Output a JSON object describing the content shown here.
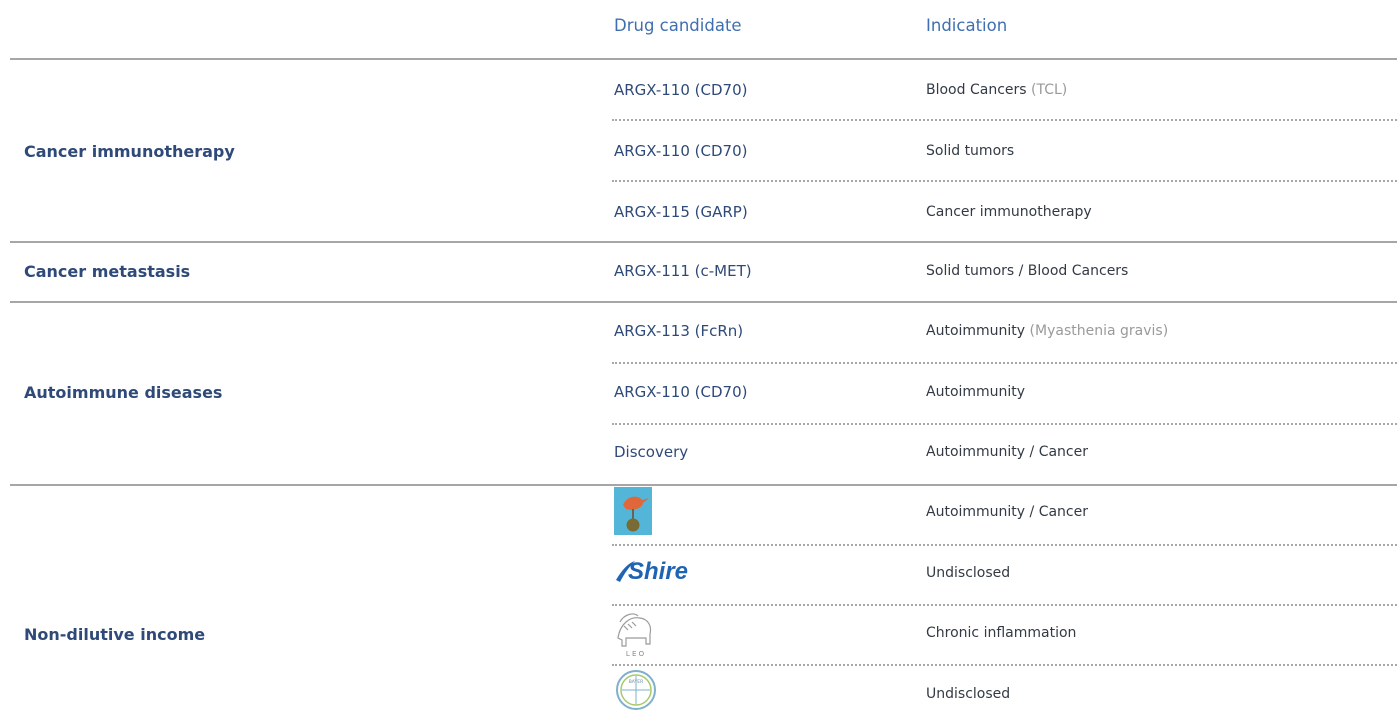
{
  "header": {
    "drug_candidate": "Drug candidate",
    "indication": "Indication"
  },
  "groups": [
    {
      "category": "Cancer immunotherapy"
    },
    {
      "category": "Cancer metastasis"
    },
    {
      "category": "Autoimmune diseases"
    },
    {
      "category": "Non-dilutive income"
    }
  ],
  "rows": [
    {
      "drug": "ARGX-110 (CD70)",
      "indication": "Blood Cancers",
      "indication_note": "(TCL)"
    },
    {
      "drug": "ARGX-110 (CD70)",
      "indication": "Solid tumors",
      "indication_note": ""
    },
    {
      "drug": "ARGX-115 (GARP)",
      "indication": "Cancer immunotherapy",
      "indication_note": ""
    },
    {
      "drug": "ARGX-111 (c-MET)",
      "indication": "Solid tumors / Blood Cancers",
      "indication_note": ""
    },
    {
      "drug": "ARGX-113 (FcRn)",
      "indication": "Autoimmunity",
      "indication_note": "(Myasthenia gravis)"
    },
    {
      "drug": "ARGX-110 (CD70)",
      "indication": "Autoimmunity",
      "indication_note": ""
    },
    {
      "drug": "Discovery",
      "indication": "Autoimmunity / Cancer",
      "indication_note": ""
    },
    {
      "drug_logo": "bird-logo",
      "indication": "Autoimmunity / Cancer",
      "indication_note": ""
    },
    {
      "drug_logo": "shire-logo",
      "logo_text": "Shire",
      "indication": "Undisclosed",
      "indication_note": ""
    },
    {
      "drug_logo": "lion-logo",
      "logo_text": "L E O",
      "indication": "Chronic inflammation",
      "indication_note": ""
    },
    {
      "drug_logo": "bayer-logo",
      "logo_text": "BAYER",
      "indication": "Undisclosed",
      "indication_note": ""
    }
  ],
  "colors": {
    "header_blue": "#3f6fb0",
    "text_navy": "#2f4a78",
    "rule_gray": "#a6a6a6",
    "note_gray": "#9a9a9a",
    "shire_blue": "#1f64b3",
    "bird_teal": "#53b6d9",
    "bird_orange": "#e0673a"
  }
}
